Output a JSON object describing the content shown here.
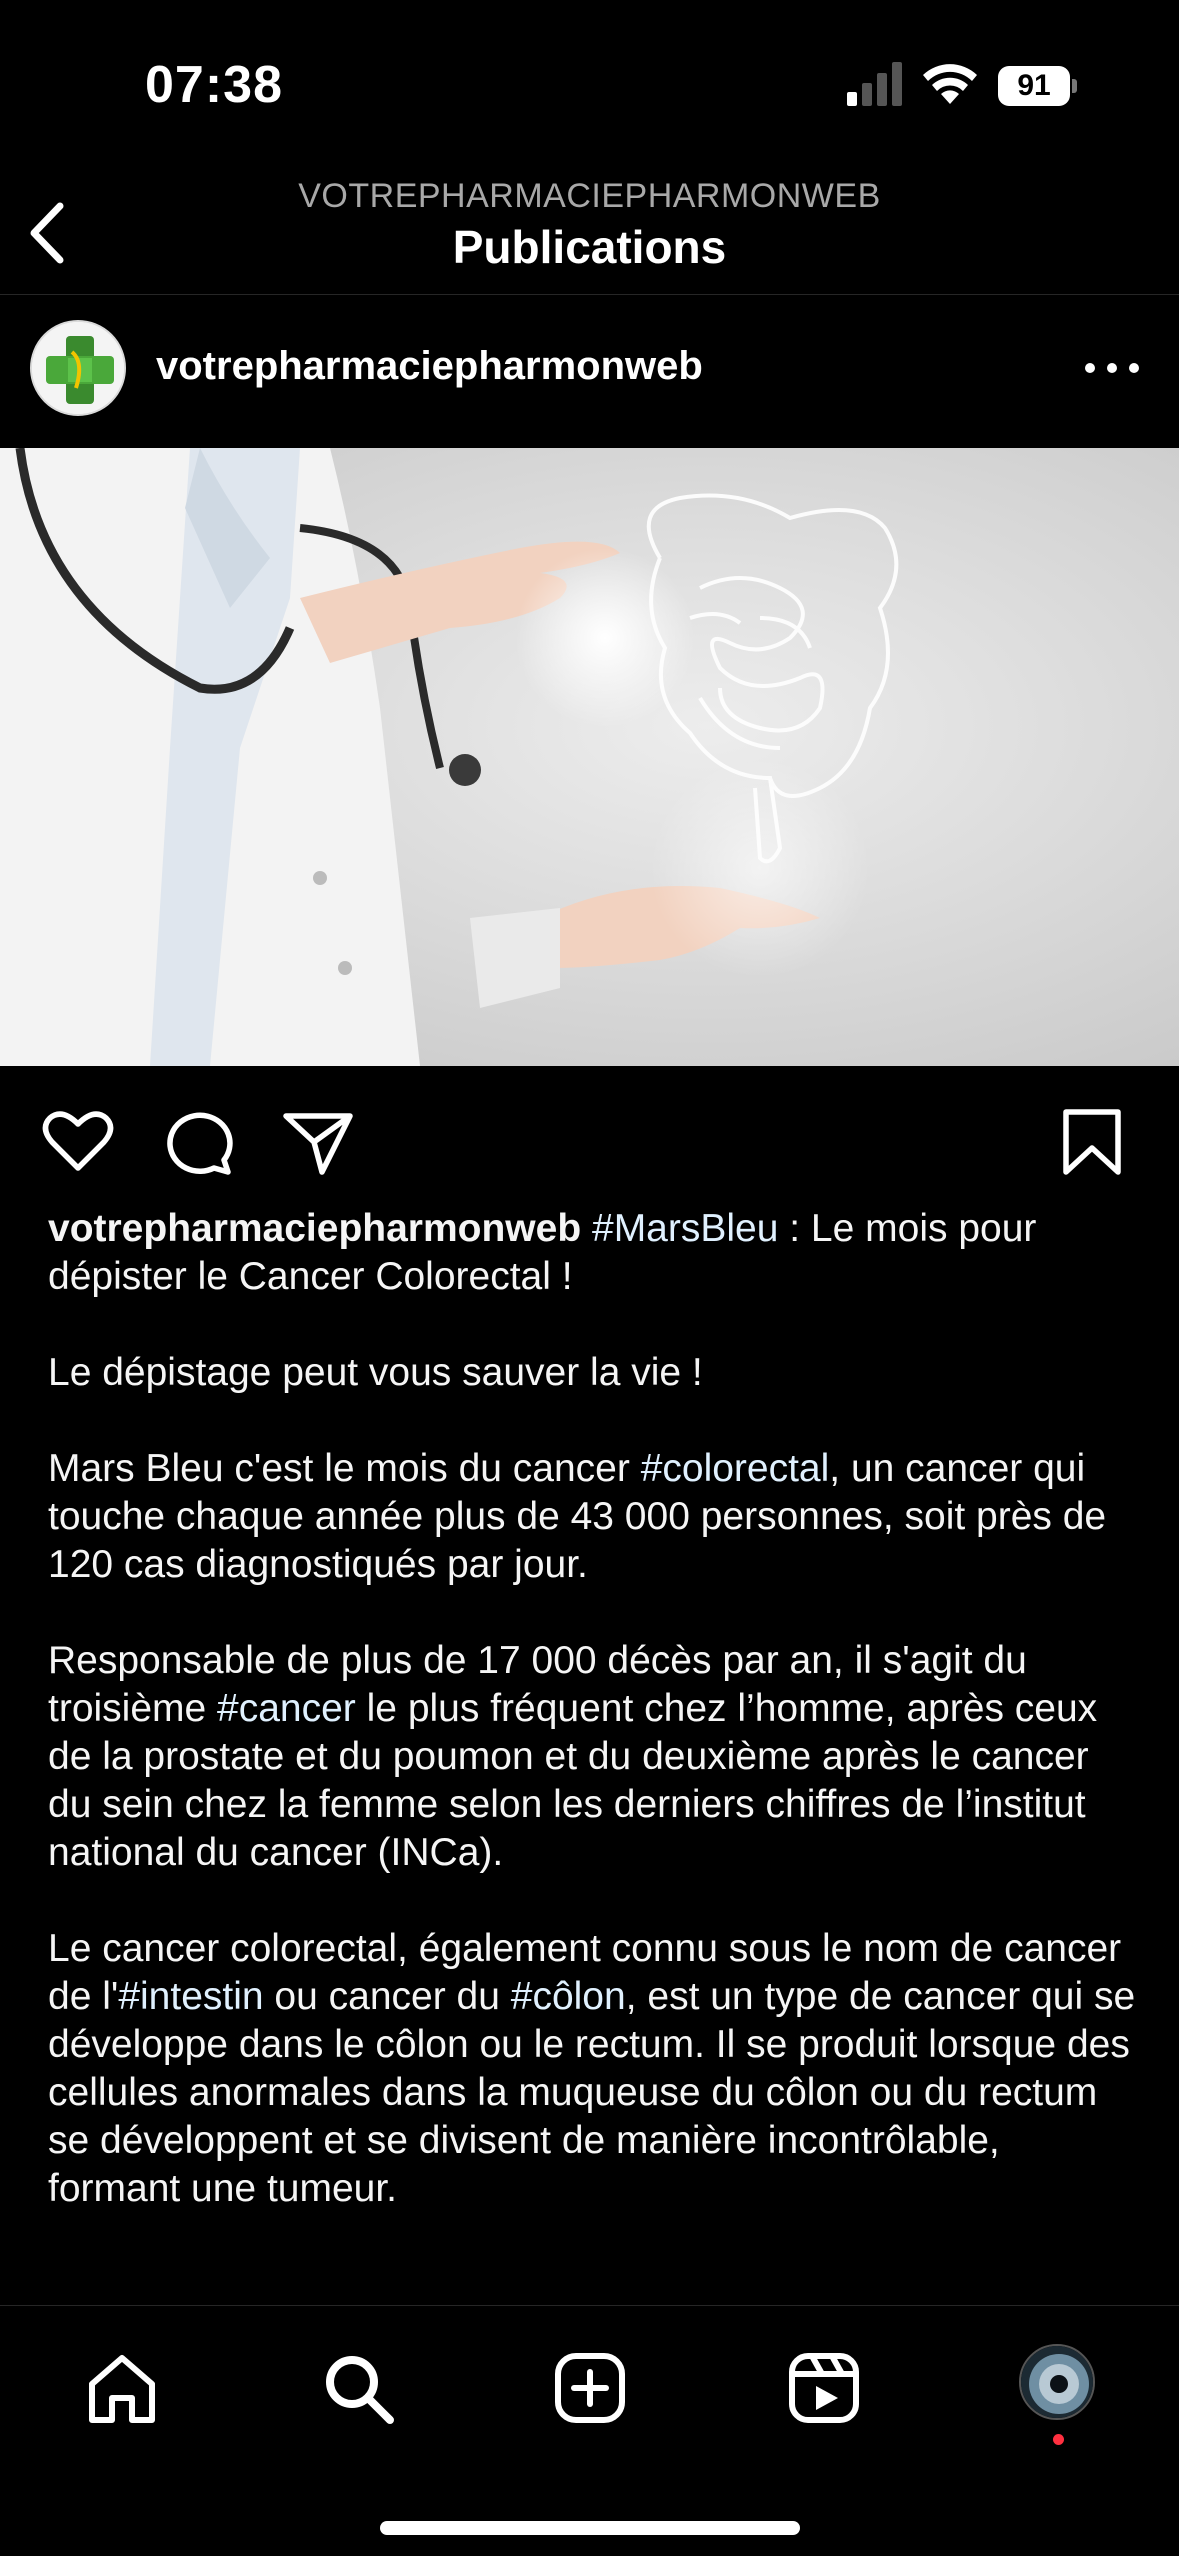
{
  "status_bar": {
    "time": "07:38",
    "battery": "91",
    "signal_bars_active": 1,
    "signal_bars_total": 4
  },
  "header": {
    "account": "VOTREPHARMACIEPHARMONWEB",
    "title": "Publications"
  },
  "post": {
    "username": "votrepharmaciepharmonweb",
    "avatar_icon": "pharmacy-cross-logo-icon",
    "image_alt": "doctor holding hologram of intestines",
    "actions": {
      "like_icon": "heart-icon",
      "comment_icon": "comment-icon",
      "share_icon": "send-icon",
      "save_icon": "bookmark-icon"
    },
    "caption": {
      "username": "votrepharmaciepharmonweb",
      "p1": {
        "tag": "#MarsBleu",
        "text": " : Le mois pour dépister le Cancer Colorectal !"
      },
      "p2": "Le dépistage peut vous sauver la vie !",
      "p3": {
        "a": "Mars Bleu c'est le mois du cancer ",
        "tag": "#colorectal",
        "b": ", un cancer qui touche chaque année plus de 43 000 personnes, soit près de 120 cas diagnostiqués par jour."
      },
      "p4": {
        "a": "Responsable de plus de 17 000 décès par an, il s'agit du troisième ",
        "tag": "#cancer",
        "b": " le plus fréquent chez l’homme, après ceux de la prostate et du poumon et du deuxième après le cancer du sein chez la femme selon les derniers chiffres de l’institut national du cancer (INCa)."
      },
      "p5": {
        "a": "Le cancer colorectal, également connu sous le nom de cancer de l'",
        "tag1": "#intestin",
        "b": " ou cancer du ",
        "tag2": "#côlon",
        "c": ", est un type de cancer qui se développe dans le côlon ou le rectum. Il se produit lorsque des cellules anormales dans la muqueuse du côlon ou du rectum se développent et se divisent de manière incontrôlable, formant une tumeur."
      }
    }
  },
  "tabbar": {
    "items": [
      "home-icon",
      "search-icon",
      "create-icon",
      "reels-icon",
      "profile-icon"
    ],
    "has_notification": true
  },
  "colors": {
    "background": "#000000",
    "text": "#ffffff",
    "secondary_text": "#a8a8a8",
    "hashtag": "#e0f1ff",
    "notification": "#ff3040"
  }
}
